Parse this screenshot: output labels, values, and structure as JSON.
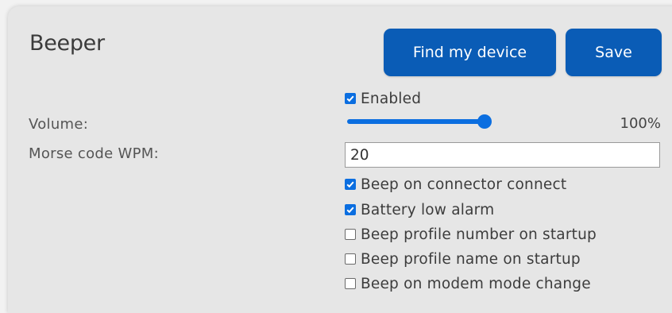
{
  "section": {
    "title": "Beeper"
  },
  "buttons": {
    "find_device": "Find my device",
    "save": "Save"
  },
  "enabled": {
    "label": "Enabled",
    "checked": true
  },
  "volume": {
    "label": "Volume:",
    "value_text": "100%",
    "level": 100
  },
  "morse": {
    "label": "Morse code WPM:",
    "value": "20"
  },
  "options": [
    {
      "label": "Beep on connector connect",
      "checked": true
    },
    {
      "label": "Battery low alarm",
      "checked": true
    },
    {
      "label": "Beep profile number on startup",
      "checked": false
    },
    {
      "label": "Beep profile name on startup",
      "checked": false
    },
    {
      "label": "Beep on modem mode change",
      "checked": false
    }
  ],
  "colors": {
    "accent": "#0a5cb6",
    "checkbox": "#0b6ee0",
    "panel_bg": "#e6e6e6"
  }
}
